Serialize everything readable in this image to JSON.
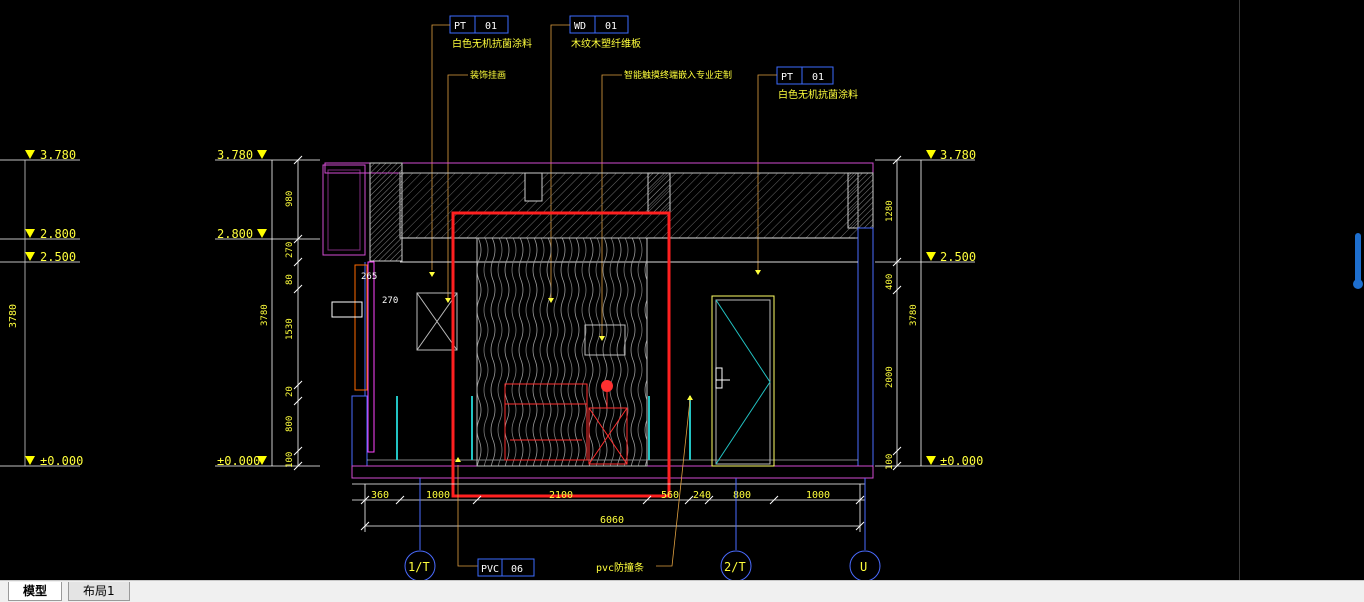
{
  "tabs": [
    {
      "label": "模型"
    },
    {
      "label": "布局1"
    }
  ],
  "tags": {
    "pt_top": {
      "code": "PT",
      "num": "01",
      "desc": "白色无机抗菌涂料"
    },
    "wd_top": {
      "code": "WD",
      "num": "01",
      "desc": "木纹木塑纤维板"
    },
    "pt_right": {
      "code": "PT",
      "num": "01",
      "desc": "白色无机抗菌涂料"
    },
    "pvc_bottom": {
      "code": "PVC",
      "num": "06"
    }
  },
  "notes": {
    "decor_panel": "装饰挂画",
    "smart_cabinet": "智能触摸终端嵌入专业定制",
    "pvc_guard": "pvc防撞条"
  },
  "elevations": {
    "left_a": [
      "3.780",
      "2.800",
      "2.500",
      "±0.000"
    ],
    "left_b": [
      "3.780",
      "2.800",
      "±0.000"
    ],
    "right": [
      "3.780",
      "2.500",
      "±0.000"
    ]
  },
  "dims": {
    "left_outer": "3780",
    "left_inner": [
      "980",
      "270",
      "80",
      "1530",
      "20",
      "800",
      "100"
    ],
    "left_inner_total": "3780",
    "right_inner": [
      "1280",
      "400",
      "2000",
      "100"
    ],
    "right_inner_total": "3780",
    "bottom": [
      "360",
      "1000",
      "2100",
      "560",
      "240",
      "800",
      "1000"
    ],
    "bottom_total": "6060",
    "small": [
      "265",
      "270"
    ]
  },
  "axes": [
    "1/T",
    "2/T",
    "U"
  ]
}
